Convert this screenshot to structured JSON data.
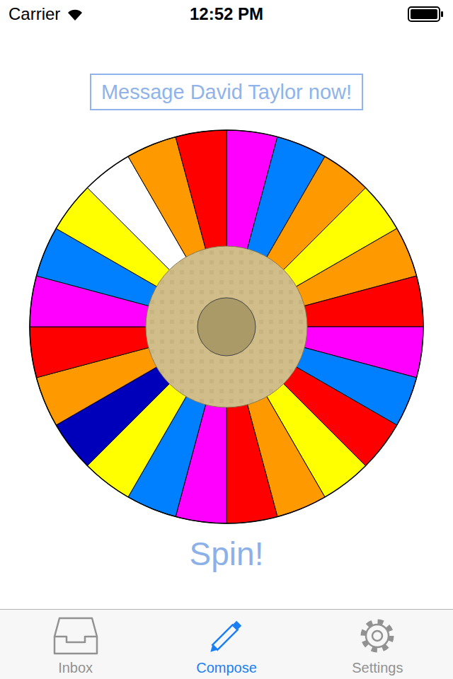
{
  "status_bar": {
    "carrier": "Carrier",
    "time": "12:52 PM"
  },
  "message_button": "Message David Taylor now!",
  "wheel": {
    "segments": [
      {
        "color": "#ff00ff"
      },
      {
        "color": "#0080ff"
      },
      {
        "color": "#ff9900"
      },
      {
        "color": "#ffff00"
      },
      {
        "color": "#ff9900"
      },
      {
        "color": "#ff0000"
      },
      {
        "color": "#ff00ff"
      },
      {
        "color": "#0080ff"
      },
      {
        "color": "#ff0000"
      },
      {
        "color": "#ffff00"
      },
      {
        "color": "#ff9900"
      },
      {
        "color": "#ff0000"
      },
      {
        "color": "#ff00ff"
      },
      {
        "color": "#0080ff"
      },
      {
        "color": "#ffff00"
      },
      {
        "color": "#0000bb"
      },
      {
        "color": "#ff9900"
      },
      {
        "color": "#ff0000"
      },
      {
        "color": "#ff00ff"
      },
      {
        "color": "#0080ff"
      },
      {
        "color": "#ffff00"
      },
      {
        "color": "#ffffff"
      },
      {
        "color": "#ff9900"
      },
      {
        "color": "#ff0000"
      }
    ]
  },
  "spin_button": "Spin!",
  "tabs": [
    {
      "label": "Inbox",
      "selected": false
    },
    {
      "label": "Compose",
      "selected": true
    },
    {
      "label": "Settings",
      "selected": false
    }
  ]
}
